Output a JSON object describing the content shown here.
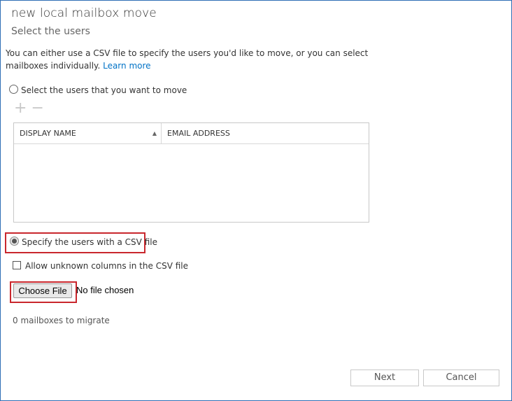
{
  "dialog": {
    "title": "new local mailbox move",
    "subtitle": "Select the users",
    "description": "You can either use a CSV file to specify the users you'd like to move, or you can select mailboxes individually.",
    "learn_more": "Learn more"
  },
  "select_users": {
    "radio_label": "Select the users that you want to move",
    "selected": false,
    "add_icon": "plus-icon",
    "remove_icon": "minus-icon"
  },
  "table": {
    "columns": [
      "DISPLAY NAME",
      "EMAIL ADDRESS"
    ],
    "sort_icon": "sort-ascending-icon",
    "rows": []
  },
  "csv": {
    "radio_label": "Specify the users with a CSV file",
    "selected": true,
    "allow_unknown_label": "Allow unknown columns in the CSV file",
    "allow_unknown_checked": false,
    "choose_file_label": "Choose File",
    "no_file_text": "No file chosen"
  },
  "status": {
    "count_text": "0 mailboxes to migrate"
  },
  "footer": {
    "next_label": "Next",
    "cancel_label": "Cancel"
  },
  "colors": {
    "link": "#0072c6",
    "highlight": "#c9272d",
    "frame": "#2f6fb5"
  }
}
